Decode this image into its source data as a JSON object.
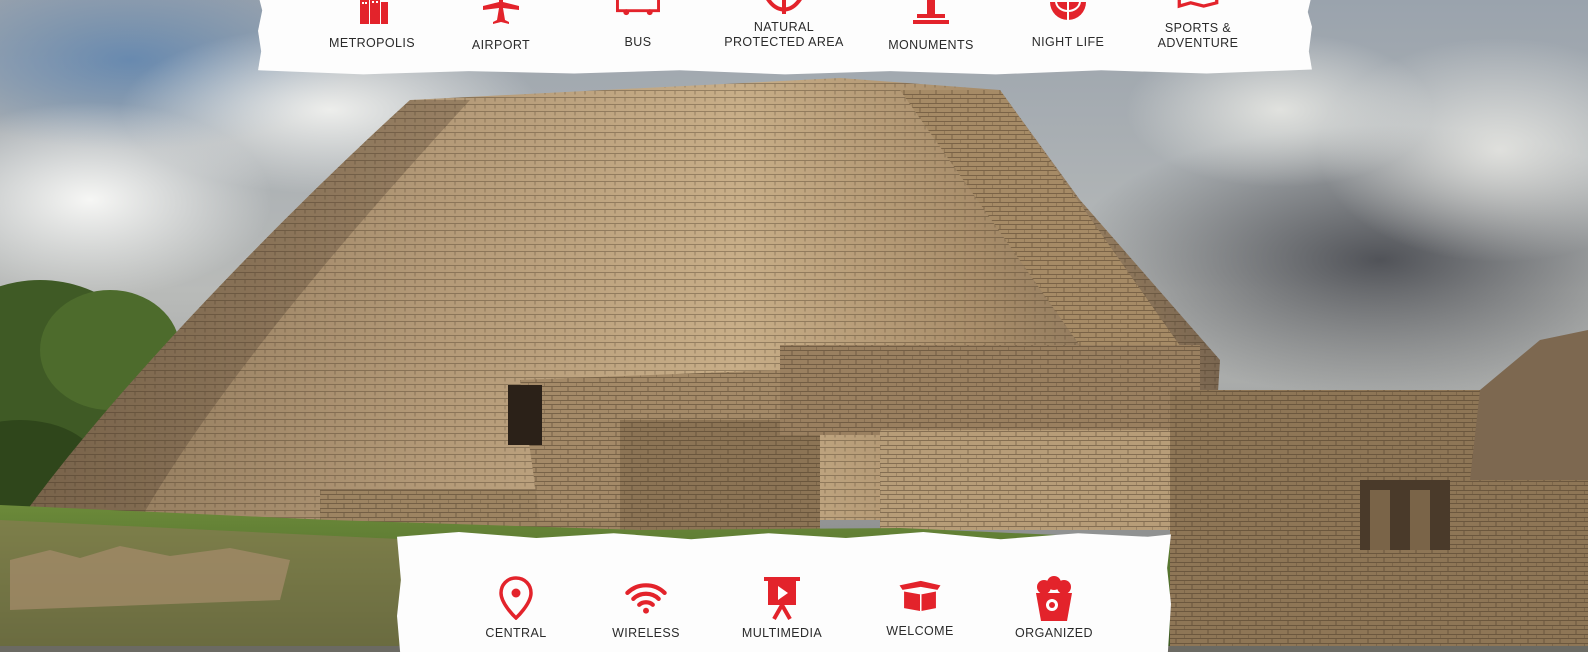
{
  "colors": {
    "accent": "#e3232b",
    "label": "#2b2b2b",
    "card": "#fdfdfd"
  },
  "top_categories": [
    {
      "icon": "city-buildings-icon",
      "label": "METROPOLIS"
    },
    {
      "icon": "airplane-icon",
      "label": "AIRPORT"
    },
    {
      "icon": "bus-icon",
      "label": "BUS"
    },
    {
      "icon": "leaf-icon",
      "label_line1": "NATURAL",
      "label_line2": "PROTECTED AREA"
    },
    {
      "icon": "monument-icon",
      "label": "MONUMENTS"
    },
    {
      "icon": "disco-ball-icon",
      "label": "NIGHT LIFE"
    },
    {
      "icon": "map-icon",
      "label_line1": "SPORTS &",
      "label_line2": "ADVENTURE"
    }
  ],
  "bottom_services": [
    {
      "icon": "location-pin-icon",
      "label": "CENTRAL"
    },
    {
      "icon": "wifi-icon",
      "label": "WIRELESS"
    },
    {
      "icon": "projector-screen-icon",
      "label": "MULTIMEDIA"
    },
    {
      "icon": "gift-box-icon",
      "label": "WELCOME"
    },
    {
      "icon": "popcorn-icon",
      "label": "ORGANIZED"
    }
  ],
  "background": {
    "subject": "pyramid-ruins-photo"
  }
}
